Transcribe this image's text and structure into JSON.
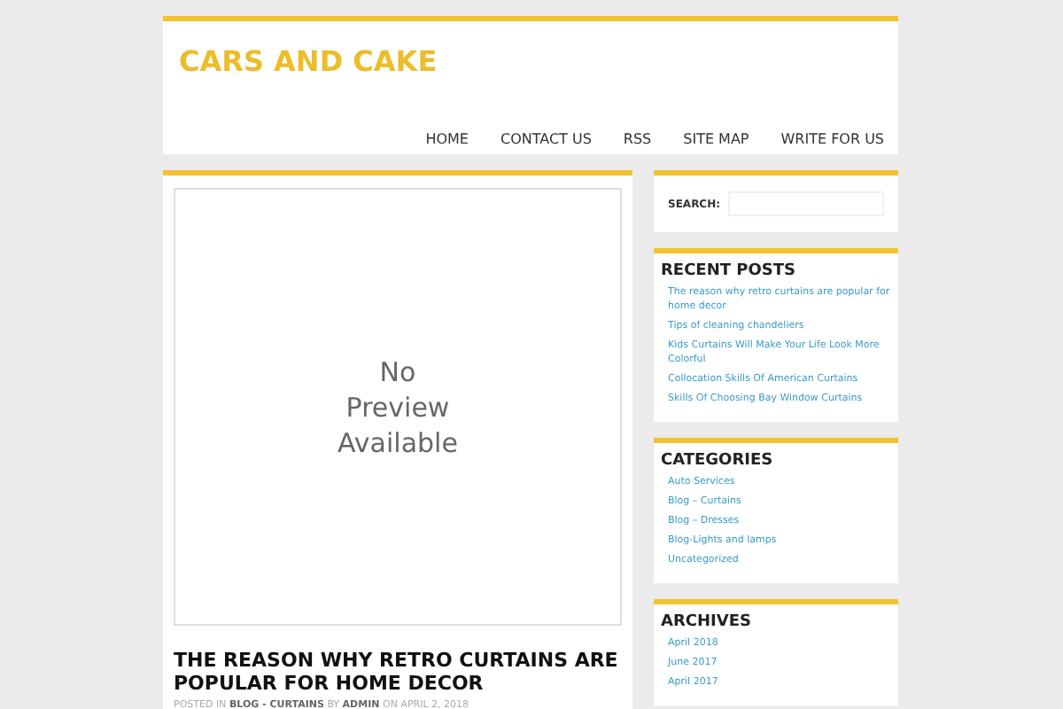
{
  "site_title": "CARS AND CAKE",
  "nav": [
    {
      "label": "HOME"
    },
    {
      "label": "CONTACT US"
    },
    {
      "label": "RSS"
    },
    {
      "label": "SITE MAP"
    },
    {
      "label": "WRITE FOR US"
    }
  ],
  "post": {
    "preview_lines": [
      "No",
      "Preview",
      "Available"
    ],
    "title": "THE REASON WHY RETRO CURTAINS ARE POPULAR FOR HOME DECOR",
    "meta": "POSTED IN **BLOG - CURTAINS** BY **ADMIN** ON APRIL 2, 2018"
  },
  "search": {
    "label": "SEARCH:"
  },
  "widgets": [
    {
      "title": "RECENT POSTS",
      "links": [
        "The reason why retro curtains are popular for home decor",
        "Tips of cleaning chandeliers",
        "Kids Curtains Will Make Your Life Look More Colorful",
        "Collocation Skills Of American Curtains",
        "Skills Of Choosing Bay Window Curtains"
      ]
    },
    {
      "title": "CATEGORIES",
      "links": [
        "Auto Services",
        "Blog – Curtains",
        "Blog – Dresses",
        "Blog-Lights and lamps",
        "Uncategorized"
      ]
    },
    {
      "title": "ARCHIVES",
      "links": [
        "April 2018",
        "June 2017",
        "April 2017"
      ]
    }
  ]
}
